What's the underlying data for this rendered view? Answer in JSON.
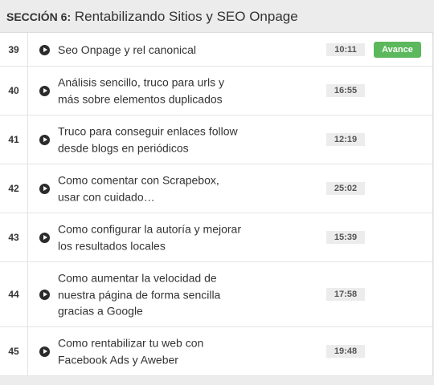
{
  "section": {
    "label": "SECCIÓN 6:",
    "title": "Rentabilizando Sitios y SEO Onpage"
  },
  "lessons": [
    {
      "number": "39",
      "title": "Seo Onpage y rel canonical",
      "duration": "10:11",
      "badge": "Avance"
    },
    {
      "number": "40",
      "title": "Análisis sencillo, truco para urls y más sobre elementos duplicados",
      "duration": "16:55"
    },
    {
      "number": "41",
      "title": "Truco para conseguir enlaces follow desde blogs en periódicos",
      "duration": "12:19"
    },
    {
      "number": "42",
      "title": "Como comentar con Scrapebox, usar con cuidado…",
      "duration": "25:02"
    },
    {
      "number": "43",
      "title": "Como configurar la autoría y mejorar los resultados locales",
      "duration": "15:39"
    },
    {
      "number": "44",
      "title": "Como aumentar la velocidad de nuestra página de forma sencilla gracias a Google",
      "duration": "17:58"
    },
    {
      "number": "45",
      "title": "Como rentabilizar tu web con Facebook Ads y Aweber",
      "duration": "19:48"
    }
  ],
  "colors": {
    "badge": "#5cb85c",
    "duration_bg": "#ececec",
    "header_bg": "#ececec"
  },
  "icons": {
    "play": "play-circle-icon"
  }
}
